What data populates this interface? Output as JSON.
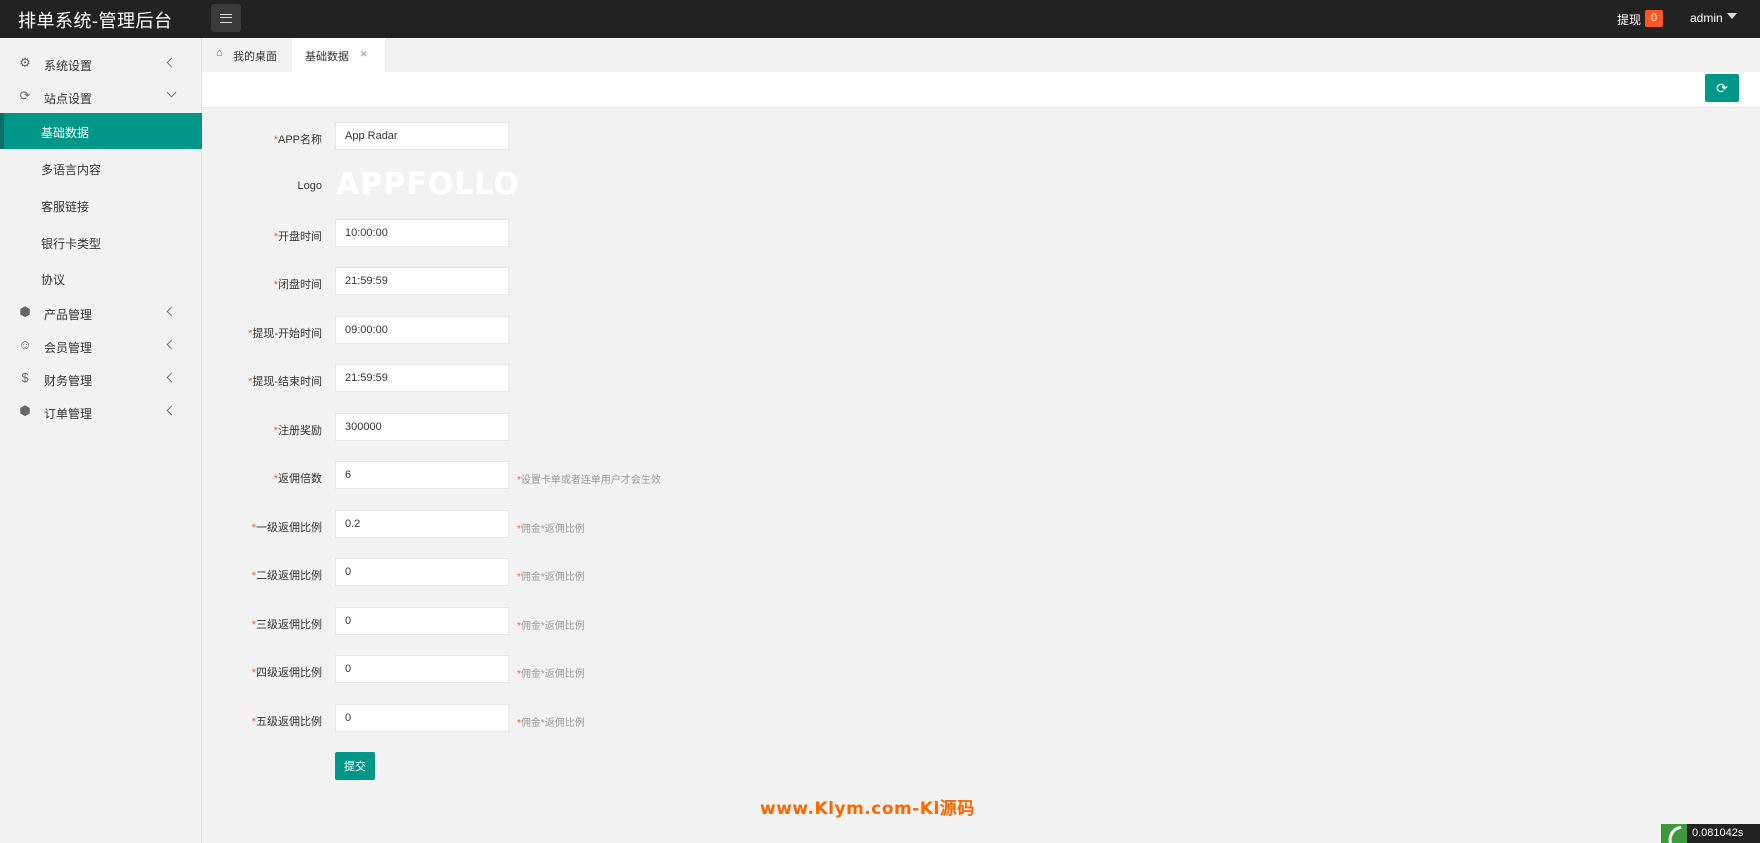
{
  "header": {
    "title": "排单系统-管理后台",
    "withdraw_label": "提现",
    "withdraw_count": "0",
    "user": "admin"
  },
  "sidebar": {
    "items": [
      {
        "label": "系统设置",
        "icon": "gear-icon"
      },
      {
        "label": "站点设置",
        "icon": "site-icon"
      },
      {
        "label": "产品管理",
        "icon": "box-icon"
      },
      {
        "label": "会员管理",
        "icon": "user-icon"
      },
      {
        "label": "财务管理",
        "icon": "dollar-icon"
      },
      {
        "label": "订单管理",
        "icon": "box-icon"
      }
    ],
    "sub_items": [
      "基础数据",
      "多语言内容",
      "客服链接",
      "银行卡类型",
      "协议"
    ]
  },
  "tabs": [
    {
      "label": "我的桌面",
      "icon": "home-icon"
    },
    {
      "label": "基础数据",
      "active": true
    }
  ],
  "form": {
    "fields": [
      {
        "label": "APP名称",
        "value": "App Radar",
        "required": true
      },
      {
        "label": "Logo",
        "logo_text": "APPFOLLO",
        "required": false
      },
      {
        "label": "开盘时间",
        "value": "10:00:00",
        "required": true
      },
      {
        "label": "闭盘时间",
        "value": "21:59:59",
        "required": true
      },
      {
        "label": "提现-开始时间",
        "value": "09:00:00",
        "required": true
      },
      {
        "label": "提现-结束时间",
        "value": "21:59:59",
        "required": true
      },
      {
        "label": "注册奖励",
        "value": "300000",
        "required": true
      },
      {
        "label": "返佣倍数",
        "value": "6",
        "required": true,
        "tip": "设置卡单或者连单用户才会生效"
      },
      {
        "label": "一级返佣比例",
        "value": "0.2",
        "required": true,
        "tip": "佣金*返佣比例"
      },
      {
        "label": "二级返佣比例",
        "value": "0",
        "required": true,
        "tip": "佣金*返佣比例"
      },
      {
        "label": "三级返佣比例",
        "value": "0",
        "required": true,
        "tip": "佣金*返佣比例"
      },
      {
        "label": "四级返佣比例",
        "value": "0",
        "required": true,
        "tip": "佣金*返佣比例"
      },
      {
        "label": "五级返佣比例",
        "value": "0",
        "required": true,
        "tip": "佣金*返佣比例"
      }
    ],
    "required_mark": "*",
    "submit_label": "提交"
  },
  "footer": {
    "watermark": "www.Klym.com-Kl源码",
    "timer": "0.081042s"
  },
  "colors": {
    "primary": "#009688",
    "header_bg": "#222222",
    "badge": "#ff5722",
    "watermark": "#ff6600"
  }
}
